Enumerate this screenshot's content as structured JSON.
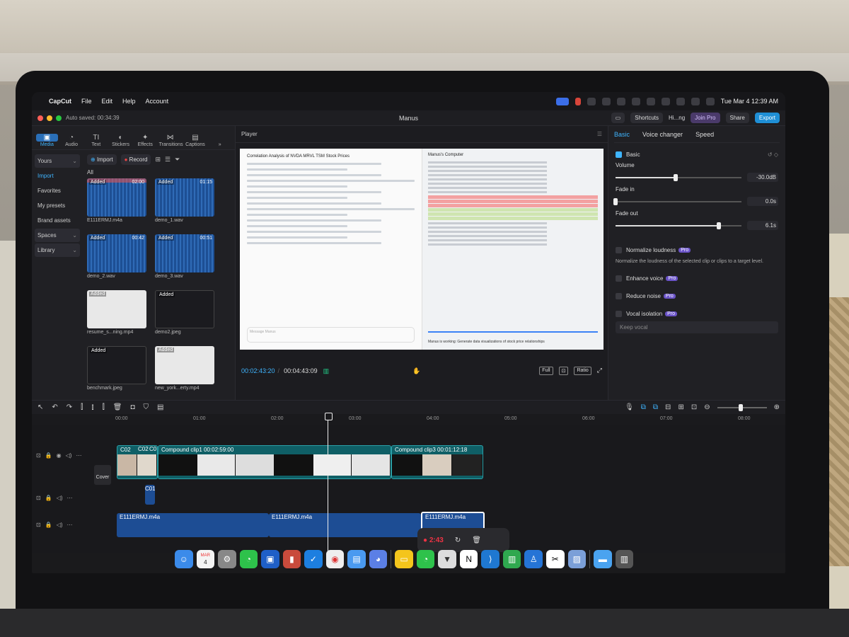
{
  "menubar": {
    "app": "CapCut",
    "items": [
      "File",
      "Edit",
      "Help",
      "Account"
    ],
    "clock": "Tue Mar 4  12:39 AM"
  },
  "titlebar": {
    "autosave": "Auto saved: 00:34:39",
    "title": "Manus",
    "shortcuts": "Shortcuts",
    "user": "Hi...ng",
    "join_pro": "Join Pro",
    "share": "Share",
    "export": "Export"
  },
  "media_tabs": [
    {
      "label": "Media",
      "icon": "media-icon"
    },
    {
      "label": "Audio",
      "icon": "audio-icon"
    },
    {
      "label": "Text",
      "icon": "text-icon"
    },
    {
      "label": "Stickers",
      "icon": "stickers-icon"
    },
    {
      "label": "Effects",
      "icon": "effects-icon"
    },
    {
      "label": "Transitions",
      "icon": "transitions-icon"
    },
    {
      "label": "Captions",
      "icon": "captions-icon"
    }
  ],
  "side_nav": {
    "yours": "Yours",
    "import": "Import",
    "favorites": "Favorites",
    "presets": "My presets",
    "brand": "Brand assets",
    "spaces": "Spaces",
    "library": "Library"
  },
  "media_toolbar": {
    "import": "Import",
    "record": "Record",
    "all": "All"
  },
  "media_items": [
    {
      "name": "E111ERMJ.m4a",
      "added": "Added",
      "duration": "02:00",
      "kind": "audio"
    },
    {
      "name": "demo_1.wav",
      "added": "Added",
      "duration": "01:15",
      "kind": "audio"
    },
    {
      "name": "demo_2.wav",
      "added": "Added",
      "duration": "00:42",
      "kind": "audio"
    },
    {
      "name": "demo_3.wav",
      "added": "Added",
      "duration": "00:51",
      "kind": "audio"
    },
    {
      "name": "resume_s...ning.mp4",
      "added": "Added",
      "duration": "",
      "kind": "doc"
    },
    {
      "name": "demo2.jpeg",
      "added": "Added",
      "duration": "",
      "kind": "dark"
    },
    {
      "name": "benchmark.jpeg",
      "added": "Added",
      "duration": "",
      "kind": "dark"
    },
    {
      "name": "new_york...erty.mp4",
      "added": "Added",
      "duration": "",
      "kind": "doc"
    }
  ],
  "player": {
    "label": "Player",
    "doc_title": "Correlation Analysis of NVDA MRVL TSM Stock Prices",
    "computer_title": "Manus's Computer",
    "message_placeholder": "Message Manus",
    "working": "Manus is working: Generate data visualizations of stock price relationships",
    "timecode_current": "00:02:43:20",
    "timecode_total": "00:04:43:09",
    "full": "Full",
    "ratio": "Ratio"
  },
  "inspector": {
    "tabs": [
      "Basic",
      "Voice changer",
      "Speed"
    ],
    "basic": "Basic",
    "volume_label": "Volume",
    "volume_value": "-30.0dB",
    "volume_level": 0.48,
    "fade_in_label": "Fade in",
    "fade_in_value": "0.0s",
    "fade_in_level": 0.0,
    "fade_out_label": "Fade out",
    "fade_out_value": "6.1s",
    "fade_out_level": 0.82,
    "normalize": "Normalize loudness",
    "normalize_desc": "Normalize the loudness of the selected clip or clips to a target level.",
    "enhance": "Enhance voice",
    "reduce": "Reduce noise",
    "vocal": "Vocal isolation",
    "keep_vocal": "Keep vocal",
    "pro": "Pro"
  },
  "timeline": {
    "ruler": [
      "00:00",
      "01:00",
      "02:00",
      "03:00",
      "04:00",
      "05:00",
      "06:00",
      "07:00",
      "08:00"
    ],
    "cover": "Cover",
    "clips": {
      "c02a": "C02",
      "c02b": "C02",
      "c02c": "C0",
      "compound1": "Compound clip1  00:02:59:00",
      "compound3": "Compound clip3  00:01:12:18",
      "c01": "C01",
      "audio": "E111ERMJ.m4a"
    }
  },
  "recording": {
    "time": "2:43"
  },
  "dock": [
    "finder-icon",
    "calendar-icon",
    "settings-icon",
    "wechat-icon",
    "app-icon",
    "ipad-icon",
    "mail-icon",
    "chrome-icon",
    "doc-icon",
    "app-icon",
    "notes-icon",
    "wechat-icon",
    "app-icon",
    "notion-icon",
    "vscode-icon",
    "numbers-icon",
    "keynote-icon",
    "capcut-icon",
    "preview-icon",
    "folder-icon",
    "trash-icon"
  ],
  "dock_calendar": {
    "month": "MAR",
    "day": "4"
  }
}
